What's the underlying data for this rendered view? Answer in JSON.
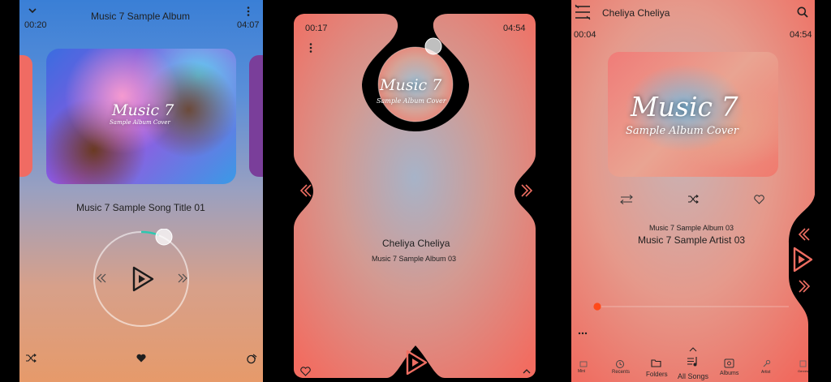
{
  "screen1": {
    "elapsed": "00:20",
    "duration": "04:07",
    "album_title": "Music 7 Sample Album",
    "cover_line1": "Music 7",
    "cover_line2": "Sample Album Cover",
    "song_title": "Music 7 Sample Song Title 01",
    "progress": 0.06,
    "icons": [
      "chevron-down-icon",
      "more-vert-icon",
      "shuffle-icon",
      "heart-icon",
      "repeat-icon",
      "play-icon",
      "previous-icon",
      "next-icon"
    ]
  },
  "screen2": {
    "elapsed": "00:17",
    "duration": "04:54",
    "cover_line1": "Music 7",
    "cover_line2": "Sample Album Cover",
    "song_title": "Cheliya Cheliya",
    "album": "Music 7 Sample Album 03",
    "icons": [
      "more-vert-icon",
      "previous-icon",
      "next-icon",
      "play-icon",
      "heart-icon",
      "chevron-up-icon"
    ]
  },
  "screen3": {
    "header_title": "Cheliya Cheliya",
    "elapsed": "00:04",
    "duration": "04:54",
    "cover_line1": "Music 7",
    "cover_line2": "Sample Album Cover",
    "album": "Music 7 Sample Album 03",
    "artist": "Music 7 Sample Artist 03",
    "progress": 0.02,
    "nav": {
      "left1": "Mini",
      "recents": "Recents",
      "folders": "Folders",
      "all_songs": "All Songs",
      "albums": "Albums",
      "artist": "Artist",
      "right1": "Genres"
    },
    "icons": [
      "menu-icon",
      "search-icon",
      "swap-icon",
      "shuffle-icon",
      "heart-icon",
      "previous-icon",
      "play-icon",
      "next-icon",
      "more-horiz-icon"
    ]
  },
  "colors": {
    "accent": "#ff4a1a",
    "coral": "#ee6e62"
  }
}
